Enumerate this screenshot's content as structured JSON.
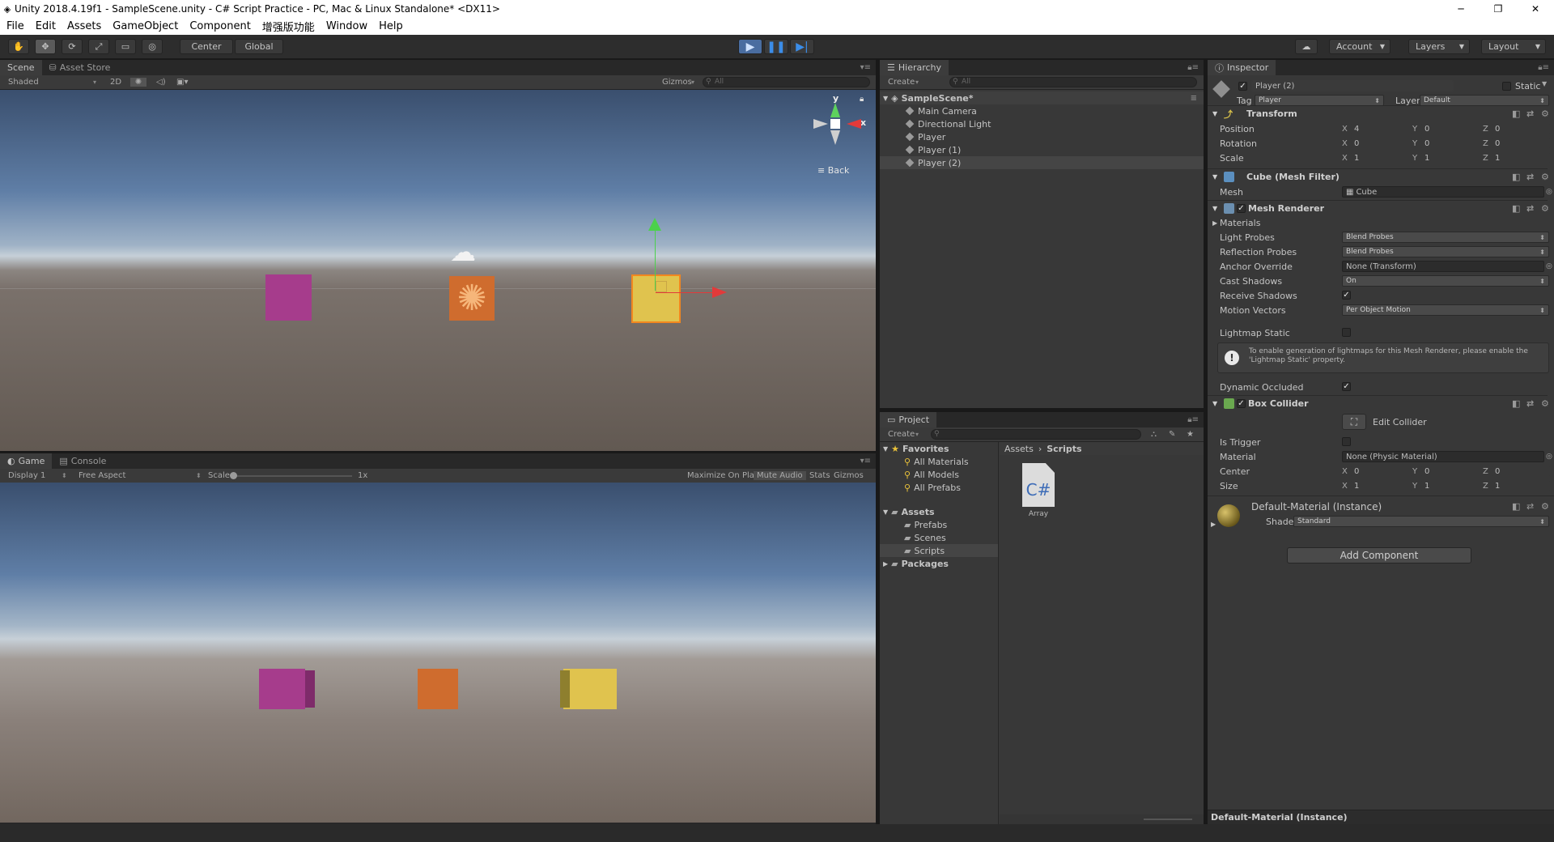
{
  "window": {
    "title": "Unity 2018.4.19f1 - SampleScene.unity - C# Script Practice - PC, Mac & Linux Standalone* <DX11>",
    "controls": [
      "─",
      "❐",
      "✕"
    ]
  },
  "menu": [
    "File",
    "Edit",
    "Assets",
    "GameObject",
    "Component",
    "增强版功能",
    "Window",
    "Help"
  ],
  "toolbar": {
    "pivot": "Center",
    "space": "Global",
    "account": "Account",
    "layers": "Layers",
    "layout": "Layout"
  },
  "scene_panel": {
    "tabs": [
      "Scene",
      "Asset Store"
    ],
    "shading": "Shaded",
    "mode_2d": "2D",
    "gizmos": "Gizmos",
    "search_placeholder": "All",
    "gizmo_label": "Back",
    "axis_y": "y",
    "axis_x": "x"
  },
  "game_panel": {
    "tabs": [
      "Game",
      "Console"
    ],
    "display": "Display 1",
    "aspect": "Free Aspect",
    "scale_label": "Scale",
    "scale_value": "1x",
    "maximize": "Maximize On Play",
    "mute": "Mute Audio",
    "stats": "Stats",
    "gizmos": "Gizmos"
  },
  "hierarchy": {
    "tab": "Hierarchy",
    "create": "Create",
    "search_placeholder": "All",
    "scene": "SampleScene*",
    "items": [
      "Main Camera",
      "Directional Light",
      "Player",
      "Player (1)",
      "Player (2)"
    ],
    "selected_index": 4
  },
  "project": {
    "tab": "Project",
    "create": "Create",
    "favorites_label": "Favorites",
    "favorites": [
      "All Materials",
      "All Models",
      "All Prefabs"
    ],
    "assets_label": "Assets",
    "assets": [
      "Prefabs",
      "Scenes",
      "Scripts"
    ],
    "packages_label": "Packages",
    "breadcrumb": [
      "Assets",
      "Scripts"
    ],
    "file_icon_text": "C#",
    "file_name": "Array"
  },
  "inspector": {
    "tab": "Inspector",
    "object_name": "Player (2)",
    "static_label": "Static",
    "tag_label": "Tag",
    "tag_value": "Player",
    "layer_label": "Layer",
    "layer_value": "Default",
    "transform": {
      "title": "Transform",
      "rows": [
        {
          "label": "Position",
          "x": "4",
          "y": "0",
          "z": "0"
        },
        {
          "label": "Rotation",
          "x": "0",
          "y": "0",
          "z": "0"
        },
        {
          "label": "Scale",
          "x": "1",
          "y": "1",
          "z": "1"
        }
      ]
    },
    "mesh_filter": {
      "title": "Cube (Mesh Filter)",
      "mesh_label": "Mesh",
      "mesh_value": "Cube"
    },
    "mesh_renderer": {
      "title": "Mesh Renderer",
      "materials": "Materials",
      "light_probes_label": "Light Probes",
      "light_probes": "Blend Probes",
      "reflection_probes_label": "Reflection Probes",
      "reflection_probes": "Blend Probes",
      "anchor_label": "Anchor Override",
      "anchor": "None (Transform)",
      "cast_label": "Cast Shadows",
      "cast": "On",
      "receive_label": "Receive Shadows",
      "motion_label": "Motion Vectors",
      "motion": "Per Object Motion",
      "lightmap_label": "Lightmap Static",
      "info": "To enable generation of lightmaps for this Mesh Renderer, please enable the 'Lightmap Static' property.",
      "dynamic_label": "Dynamic Occluded"
    },
    "box_collider": {
      "title": "Box Collider",
      "edit": "Edit Collider",
      "trigger_label": "Is Trigger",
      "material_label": "Material",
      "material": "None (Physic Material)",
      "center_label": "Center",
      "center": {
        "x": "0",
        "y": "0",
        "z": "0"
      },
      "size_label": "Size",
      "size": {
        "x": "1",
        "y": "1",
        "z": "1"
      }
    },
    "material": {
      "title": "Default-Material (Instance)",
      "shader_label": "Shader",
      "shader": "Standard"
    },
    "add_component": "Add Component",
    "footer": "Default-Material (Instance)"
  },
  "axis_letters": {
    "x": "X",
    "y": "Y",
    "z": "Z"
  },
  "colors": {
    "magenta_cube": "#a63c8c",
    "orange_cube": "#cf6c2e",
    "yellow_cube": "#e0c34e",
    "accent_play": "#3b8de8"
  }
}
